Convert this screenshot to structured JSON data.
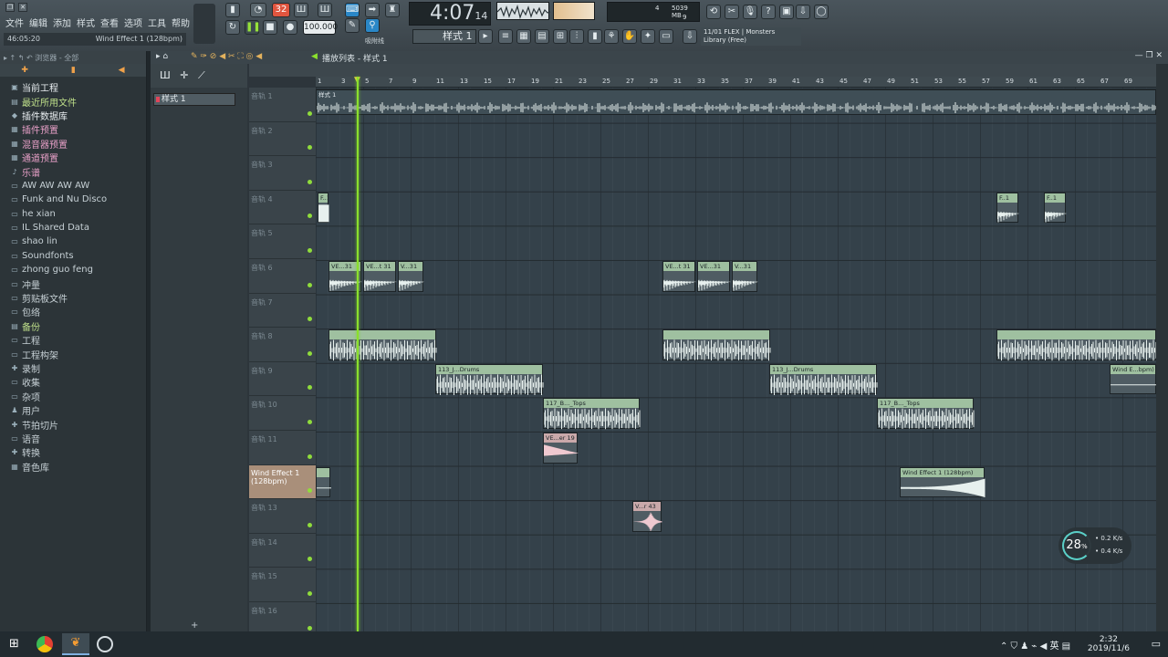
{
  "menu": [
    "文件",
    "编辑",
    "添加",
    "样式",
    "查看",
    "选项",
    "工具",
    "帮助"
  ],
  "hint": {
    "time": "46:05:20",
    "text": "Wind Effect 1 (128bpm)"
  },
  "transport": {
    "pattern_num": "32",
    "tempo": "100.000",
    "song_time": "4:07",
    "song_time_small": "14",
    "bst": "B:S:T",
    "pattern_select": "样式 1",
    "mem": "5039 MB",
    "cpu_count": "4",
    "voices": "9",
    "snap_label": "吸附线"
  },
  "news": {
    "line1": "11/01  FLEX | Monsters",
    "line2": "Library (Free)"
  },
  "browser": {
    "header": "浏览器 - 全部",
    "items": [
      {
        "label": "当前工程",
        "icon": "▣",
        "style": "white"
      },
      {
        "label": "最近所用文件",
        "icon": "▤",
        "style": "green"
      },
      {
        "label": "插件数据库",
        "icon": "◆",
        "style": "white"
      },
      {
        "label": "插件预置",
        "icon": "▦",
        "style": "pink"
      },
      {
        "label": "混音器预置",
        "icon": "▦",
        "style": "pink"
      },
      {
        "label": "通道预置",
        "icon": "▦",
        "style": "pink"
      },
      {
        "label": "乐谱",
        "icon": "♪",
        "style": "pink"
      },
      {
        "label": "AW AW AW AW",
        "icon": "▭",
        "style": ""
      },
      {
        "label": "Funk and Nu Disco",
        "icon": "▭",
        "style": ""
      },
      {
        "label": "he xian",
        "icon": "▭",
        "style": ""
      },
      {
        "label": "IL Shared Data",
        "icon": "▭",
        "style": ""
      },
      {
        "label": "shao lin",
        "icon": "▭",
        "style": ""
      },
      {
        "label": "Soundfonts",
        "icon": "▭",
        "style": ""
      },
      {
        "label": "zhong guo feng",
        "icon": "▭",
        "style": ""
      },
      {
        "label": "冲量",
        "icon": "▭",
        "style": ""
      },
      {
        "label": "剪贴板文件",
        "icon": "▭",
        "style": ""
      },
      {
        "label": "包络",
        "icon": "▭",
        "style": ""
      },
      {
        "label": "备份",
        "icon": "▤",
        "style": "green"
      },
      {
        "label": "工程",
        "icon": "▭",
        "style": ""
      },
      {
        "label": "工程构架",
        "icon": "▭",
        "style": ""
      },
      {
        "label": "录制",
        "icon": "✚",
        "style": ""
      },
      {
        "label": "收集",
        "icon": "▭",
        "style": ""
      },
      {
        "label": "杂项",
        "icon": "▭",
        "style": ""
      },
      {
        "label": "用户",
        "icon": "♟",
        "style": ""
      },
      {
        "label": "节拍切片",
        "icon": "✚",
        "style": ""
      },
      {
        "label": "语音",
        "icon": "▭",
        "style": ""
      },
      {
        "label": "转换",
        "icon": "✚",
        "style": ""
      },
      {
        "label": "音色库",
        "icon": "▦",
        "style": ""
      }
    ]
  },
  "playlist": {
    "title": "播放列表 - 样式 1",
    "pattern_item": "样式 1",
    "ruler_ticks": [
      "1",
      "3",
      "5",
      "7",
      "9",
      "11",
      "13",
      "15",
      "17",
      "19",
      "21",
      "23",
      "25",
      "27",
      "29",
      "31",
      "33",
      "35",
      "37",
      "39",
      "41",
      "43",
      "45",
      "47",
      "49",
      "51",
      "53",
      "55",
      "57",
      "59",
      "61",
      "63",
      "65",
      "67",
      "69"
    ],
    "tracks": [
      "音轨 1",
      "音轨 2",
      "音轨 3",
      "音轨 4",
      "音轨 5",
      "音轨 6",
      "音轨 7",
      "音轨 8",
      "音轨 9",
      "音轨 10",
      "音轨 11",
      "Wind Effect 1 (128bpm)",
      "音轨 13",
      "音轨 14",
      "音轨 15",
      "音轨 16"
    ],
    "clip_labels": {
      "pattern": "样式 1",
      "f": "F..1",
      "ve31": "VE...31",
      "vet31": "VE...t 31",
      "v31": "V...31",
      "drums": "113_J...Drums",
      "tops": "117_B..._Tops",
      "ve19": "VE...er 19",
      "wind": "Wind Effect 1 (128bpm)",
      "windshort": "Wind E...bpm)",
      "v43": "V...r 43"
    }
  },
  "cpu_meter": {
    "value": "28",
    "unit": "%",
    "up": "0.2",
    "down": "0.4",
    "rate_unit": "K/s"
  },
  "taskbar": {
    "time": "2:32",
    "date": "2019/11/6",
    "ime": "英"
  }
}
